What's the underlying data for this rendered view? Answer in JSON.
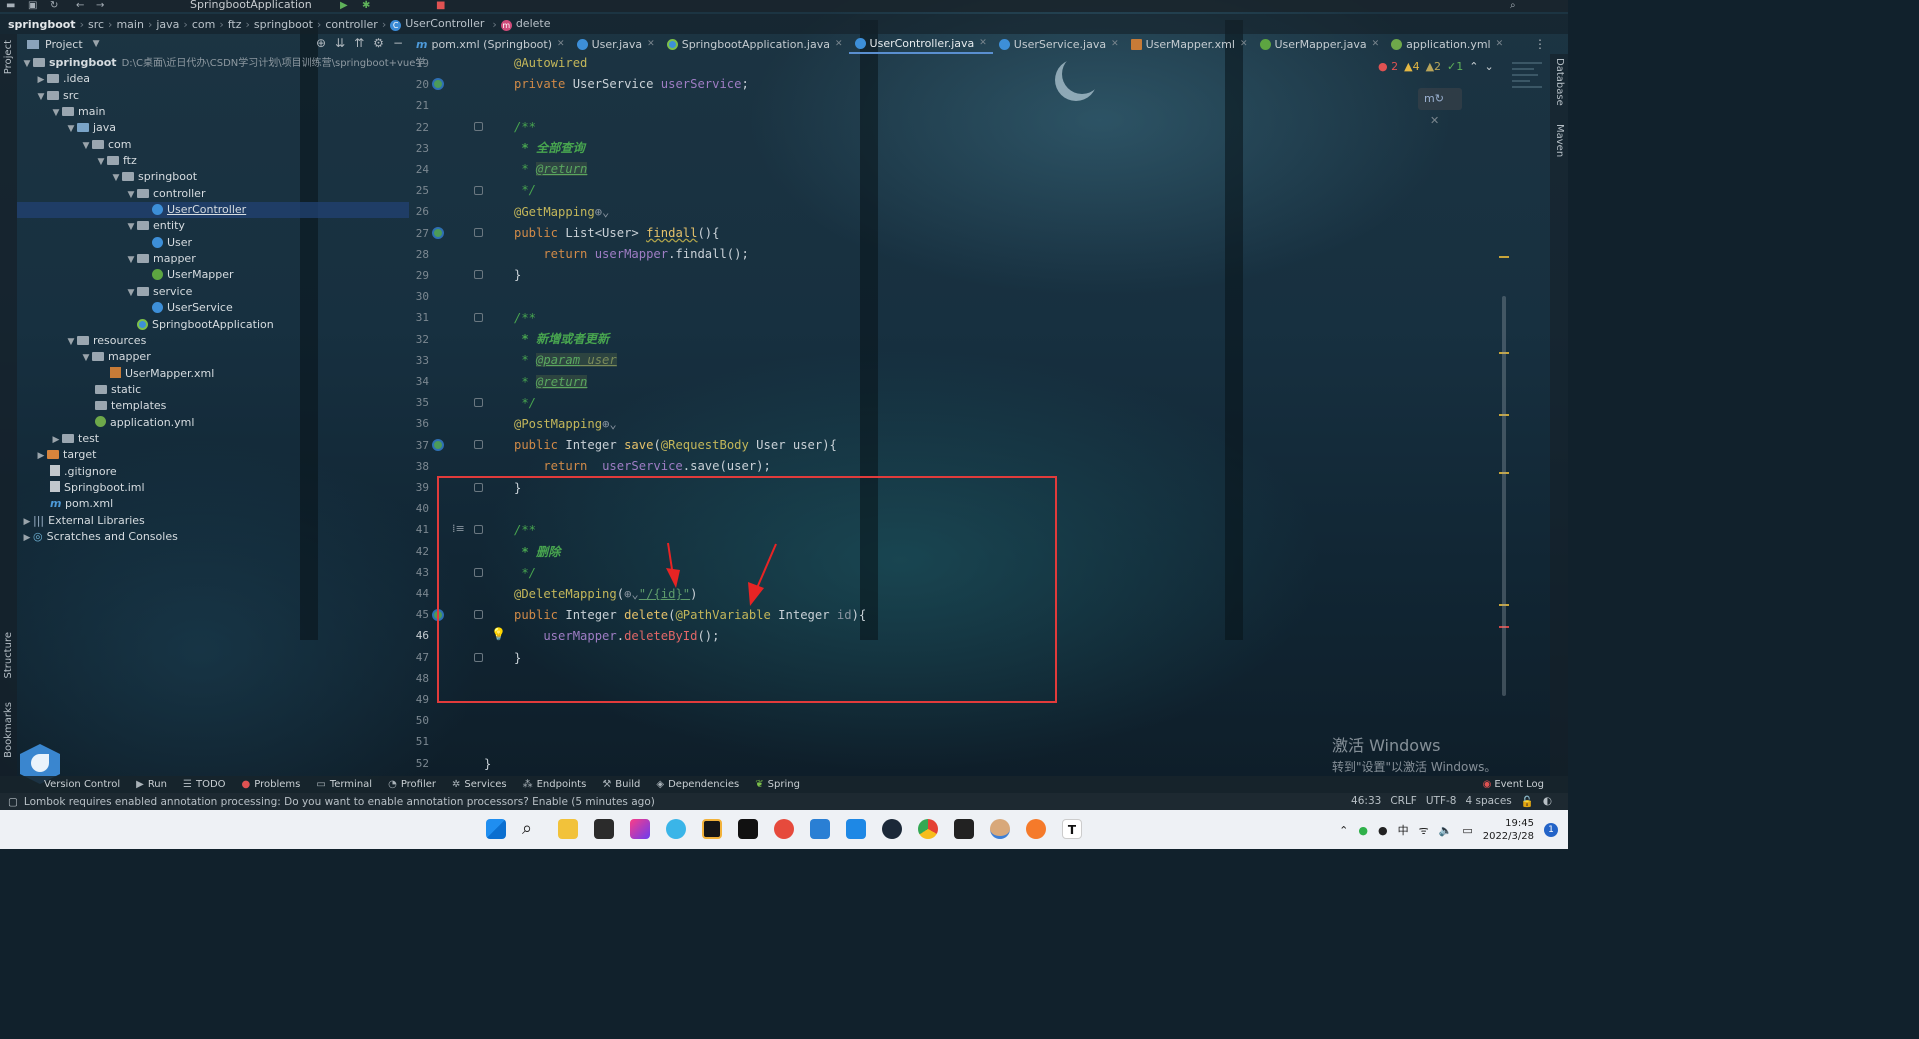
{
  "toolbar": {
    "run_config": "SpringbootApplication"
  },
  "breadcrumb": [
    "springboot",
    "src",
    "main",
    "java",
    "com",
    "ftz",
    "springboot",
    "controller",
    "UserController",
    "delete"
  ],
  "left_strip": {
    "project": "Project",
    "structure": "Structure",
    "bookmarks": "Bookmarks"
  },
  "right_strip": {
    "database": "Database",
    "maven": "Maven"
  },
  "project_panel": {
    "title": "Project"
  },
  "tree": [
    {
      "label": "springboot",
      "path": "D:\\C桌面\\近日代办\\CSDN学习计划\\项目训练营\\springboot+vue学"
    },
    {
      "label": ".idea"
    },
    {
      "label": "src"
    },
    {
      "label": "main"
    },
    {
      "label": "java"
    },
    {
      "label": "com"
    },
    {
      "label": "ftz"
    },
    {
      "label": "springboot"
    },
    {
      "label": "controller"
    },
    {
      "label": "UserController"
    },
    {
      "label": "entity"
    },
    {
      "label": "User"
    },
    {
      "label": "mapper"
    },
    {
      "label": "UserMapper"
    },
    {
      "label": "service"
    },
    {
      "label": "UserService"
    },
    {
      "label": "SpringbootApplication"
    },
    {
      "label": "resources"
    },
    {
      "label": "mapper"
    },
    {
      "label": "UserMapper.xml"
    },
    {
      "label": "static"
    },
    {
      "label": "templates"
    },
    {
      "label": "application.yml"
    },
    {
      "label": "test"
    },
    {
      "label": "target"
    },
    {
      "label": ".gitignore"
    },
    {
      "label": "Springboot.iml"
    },
    {
      "label": "pom.xml"
    },
    {
      "label": "External Libraries"
    },
    {
      "label": "Scratches and Consoles"
    }
  ],
  "tabs": [
    {
      "label": "pom.xml (Springboot)"
    },
    {
      "label": "User.java"
    },
    {
      "label": "SpringbootApplication.java"
    },
    {
      "label": "UserController.java"
    },
    {
      "label": "UserService.java"
    },
    {
      "label": "UserMapper.xml"
    },
    {
      "label": "UserMapper.java"
    },
    {
      "label": "application.yml"
    }
  ],
  "inspections": {
    "errors": "2",
    "warnings": "4",
    "weak": "2",
    "ok": "1"
  },
  "line_numbers": [
    "19",
    "20",
    "21",
    "22",
    "23",
    "24",
    "25",
    "26",
    "27",
    "28",
    "29",
    "30",
    "31",
    "32",
    "33",
    "34",
    "35",
    "36",
    "37",
    "38",
    "39",
    "40",
    "41",
    "42",
    "43",
    "44",
    "45",
    "46",
    "47",
    "48",
    "49",
    "50",
    "51",
    "52"
  ],
  "code": {
    "l19": "@Autowired",
    "l20_kw": "private ",
    "l20_type": "UserService ",
    "l20_fld": "userService",
    "l20_end": ";",
    "l22": "/**",
    "l23": " * 全部查询",
    "l24_pre": " * ",
    "l24_tag": "@return",
    "l25": " */",
    "l26": "@GetMapping",
    "l27_kw": "public ",
    "l27_type": "List<User> ",
    "l27_meth": "findall",
    "l27_end": "(){",
    "l28_kw": "    return ",
    "l28_fld": "userMapper",
    "l28_end": ".findall();",
    "l29": "}",
    "l31": "/**",
    "l32": " * 新增或者更新",
    "l33_pre": " * ",
    "l33_tag": "@param",
    "l33_par": " user",
    "l34_pre": " * ",
    "l34_tag": "@return",
    "l35": " */",
    "l36": "@PostMapping",
    "l37_kw": "public ",
    "l37_type": "Integer ",
    "l37_meth": "save",
    "l37_a": "(",
    "l37_anno": "@RequestBody",
    "l37_end": " User user){",
    "l38_kw": "    return  ",
    "l38_fld": "userService",
    "l38_end": ".save(user);",
    "l39": "}",
    "l41": "/**",
    "l42": " * 删除",
    "l43": " */",
    "l44_anno": "@DeleteMapping",
    "l44_a": "(",
    "l44_str": "\"/{id}\"",
    "l44_end": ")",
    "l45_kw": "public ",
    "l45_type": "Integer ",
    "l45_meth": "delete",
    "l45_a": "(",
    "l45_anno": "@PathVariable",
    "l45_b": " Integer ",
    "l45_par": "id",
    "l45_end": "){",
    "l46_fld": "    userMapper",
    "l46_dot": ".",
    "l46_err": "deleteById",
    "l46_end": "();",
    "l47": "}",
    "l52": "}"
  },
  "watermark": {
    "title": "激活 Windows",
    "subtitle": "转到\"设置\"以激活 Windows。"
  },
  "tool_windows": [
    "Version Control",
    "Run",
    "TODO",
    "Problems",
    "Terminal",
    "Profiler",
    "Services",
    "Endpoints",
    "Build",
    "Dependencies",
    "Spring"
  ],
  "event_log": "Event Log",
  "status": {
    "message": "Lombok requires enabled annotation processing: Do you want to enable annotation processors? Enable (5 minutes ago)",
    "position": "46:33",
    "line_sep": "CRLF",
    "encoding": "UTF-8",
    "indent": "4 spaces"
  },
  "tray": {
    "ime": "中",
    "time": "19:45",
    "date": "2022/3/28",
    "badge": "1"
  }
}
